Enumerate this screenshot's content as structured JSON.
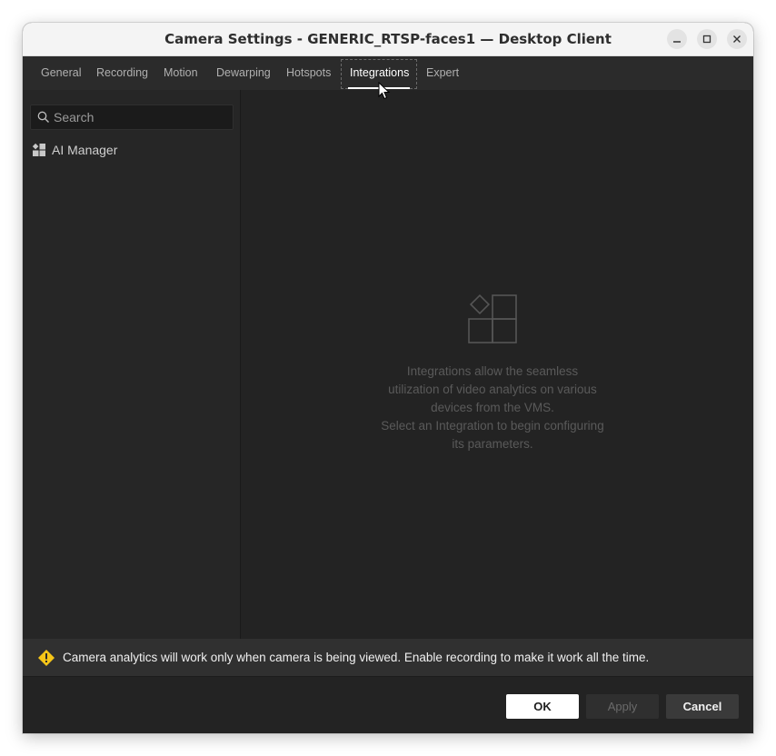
{
  "window": {
    "title": "Camera Settings - GENERIC_RTSP-faces1 — Desktop Client"
  },
  "tabs": [
    {
      "label": "General"
    },
    {
      "label": "Recording"
    },
    {
      "label": "Motion"
    },
    {
      "label": "Dewarping"
    },
    {
      "label": "Hotspots"
    },
    {
      "label": "Integrations",
      "active": true
    },
    {
      "label": "Expert"
    }
  ],
  "sidebar": {
    "search_placeholder": "Search",
    "items": [
      {
        "label": "AI Manager",
        "icon": "plugin-grid-icon"
      }
    ]
  },
  "content": {
    "icon": "integrations-placeholder-icon",
    "empty_line1": "Integrations allow the seamless",
    "empty_line2": "utilization of video analytics on various",
    "empty_line3": "devices from the VMS.",
    "empty_line4": "Select an Integration to begin configuring",
    "empty_line5": "its parameters."
  },
  "warning": {
    "icon": "warning-icon",
    "color": "#f5c518",
    "text": "Camera analytics will work only when camera is being viewed. Enable recording to make it work all the time."
  },
  "buttons": {
    "ok": "OK",
    "apply": "Apply",
    "cancel": "Cancel"
  }
}
